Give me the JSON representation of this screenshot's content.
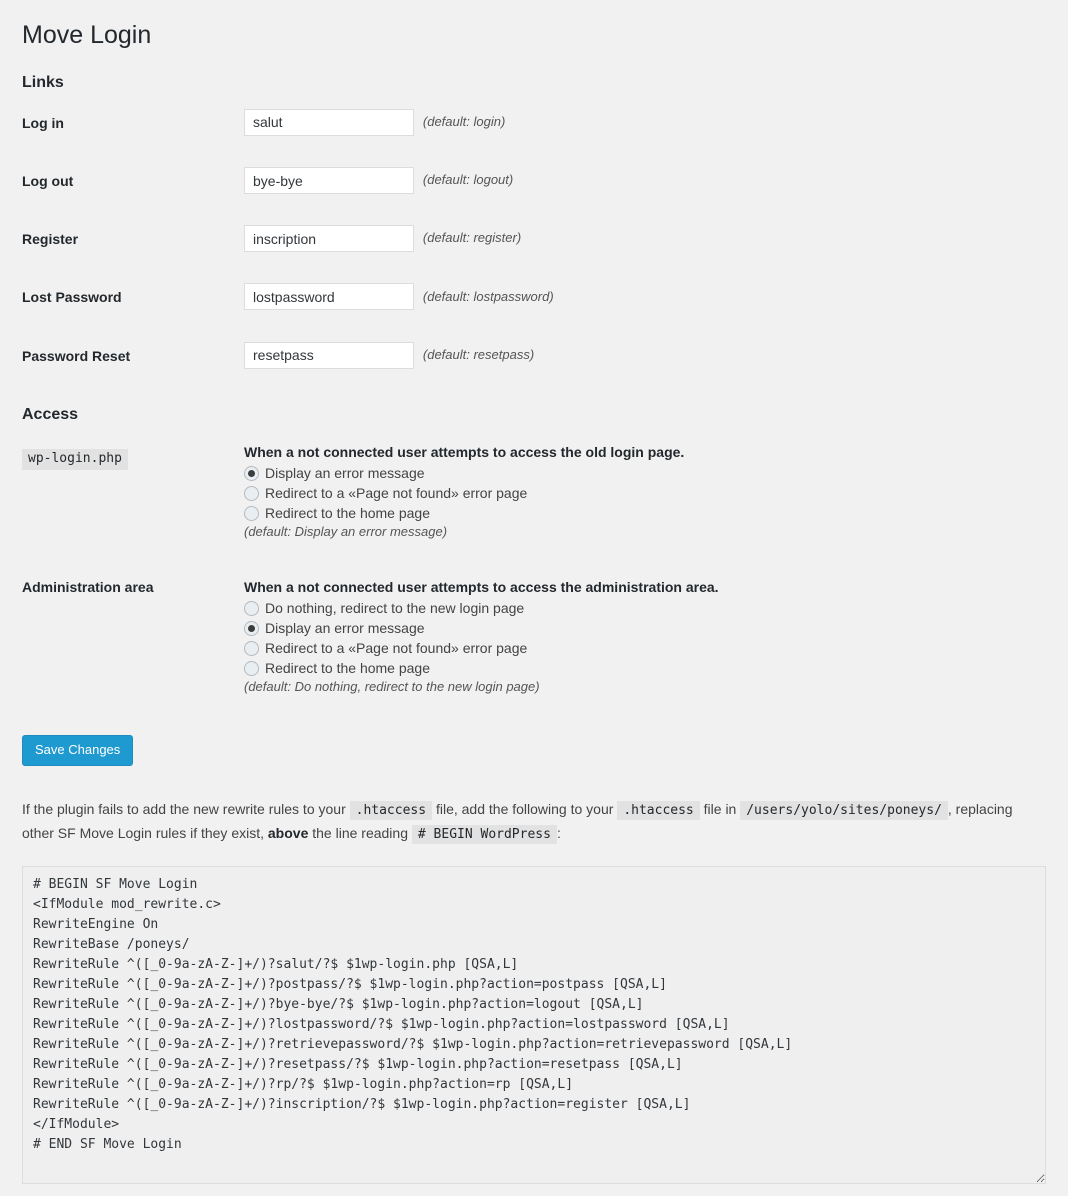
{
  "page": {
    "title": "Move Login"
  },
  "sections": {
    "links": {
      "heading": "Links",
      "rows": [
        {
          "label": "Log in",
          "value": "salut",
          "default": "(default: login)",
          "placeholder": ""
        },
        {
          "label": "Log out",
          "value": "bye-bye",
          "default": "(default: logout)",
          "placeholder": ""
        },
        {
          "label": "Register",
          "value": "inscription",
          "default": "(default: register)",
          "placeholder": ""
        },
        {
          "label": "Lost Password",
          "value": "lostpassword",
          "default": "(default: lostpassword)",
          "placeholder": ""
        },
        {
          "label": "Password Reset",
          "value": "resetpass",
          "default": "(default: resetpass)",
          "placeholder": ""
        }
      ]
    },
    "access": {
      "heading": "Access",
      "groups": [
        {
          "label": "wp-login.php",
          "label_is_code": true,
          "intro": "When a not connected user attempts to access the old login page.",
          "options": [
            {
              "text": "Display an error message",
              "checked": true
            },
            {
              "text": "Redirect to a «Page not found» error page",
              "checked": false
            },
            {
              "text": "Redirect to the home page",
              "checked": false
            }
          ],
          "default": "(default: Display an error message)"
        },
        {
          "label": "Administration area",
          "label_is_code": false,
          "intro": "When a not connected user attempts to access the administration area.",
          "options": [
            {
              "text": "Do nothing, redirect to the new login page",
              "checked": false
            },
            {
              "text": "Display an error message",
              "checked": true
            },
            {
              "text": "Redirect to a «Page not found» error page",
              "checked": false
            },
            {
              "text": "Redirect to the home page",
              "checked": false
            }
          ],
          "default": "(default: Do nothing, redirect to the new login page)"
        }
      ]
    }
  },
  "submit": {
    "save_label": "Save Changes",
    "accent_color": "#1e9ad1"
  },
  "helper": {
    "part1": "If the plugin fails to add the new rewrite rules to your",
    "code1": ".htaccess",
    "part2": "file, add the following to your",
    "code2": ".htaccess",
    "part3": "file in",
    "code3": "/users/yolo/sites/poneys/",
    "part4": ", replacing other SF Move Login rules if they exist,",
    "bold1": "above",
    "part5": "the line reading",
    "code4": "# BEGIN WordPress",
    "part6": ":"
  },
  "rules_textarea": {
    "value": "# BEGIN SF Move Login\n<IfModule mod_rewrite.c>\nRewriteEngine On\nRewriteBase /poneys/\nRewriteRule ^([_0-9a-zA-Z-]+/)?salut/?$ $1wp-login.php [QSA,L]\nRewriteRule ^([_0-9a-zA-Z-]+/)?postpass/?$ $1wp-login.php?action=postpass [QSA,L]\nRewriteRule ^([_0-9a-zA-Z-]+/)?bye-bye/?$ $1wp-login.php?action=logout [QSA,L]\nRewriteRule ^([_0-9a-zA-Z-]+/)?lostpassword/?$ $1wp-login.php?action=lostpassword [QSA,L]\nRewriteRule ^([_0-9a-zA-Z-]+/)?retrievepassword/?$ $1wp-login.php?action=retrievepassword [QSA,L]\nRewriteRule ^([_0-9a-zA-Z-]+/)?resetpass/?$ $1wp-login.php?action=resetpass [QSA,L]\nRewriteRule ^([_0-9a-zA-Z-]+/)?rp/?$ $1wp-login.php?action=rp [QSA,L]\nRewriteRule ^([_0-9a-zA-Z-]+/)?inscription/?$ $1wp-login.php?action=register [QSA,L]\n</IfModule>\n# END SF Move Login"
  }
}
